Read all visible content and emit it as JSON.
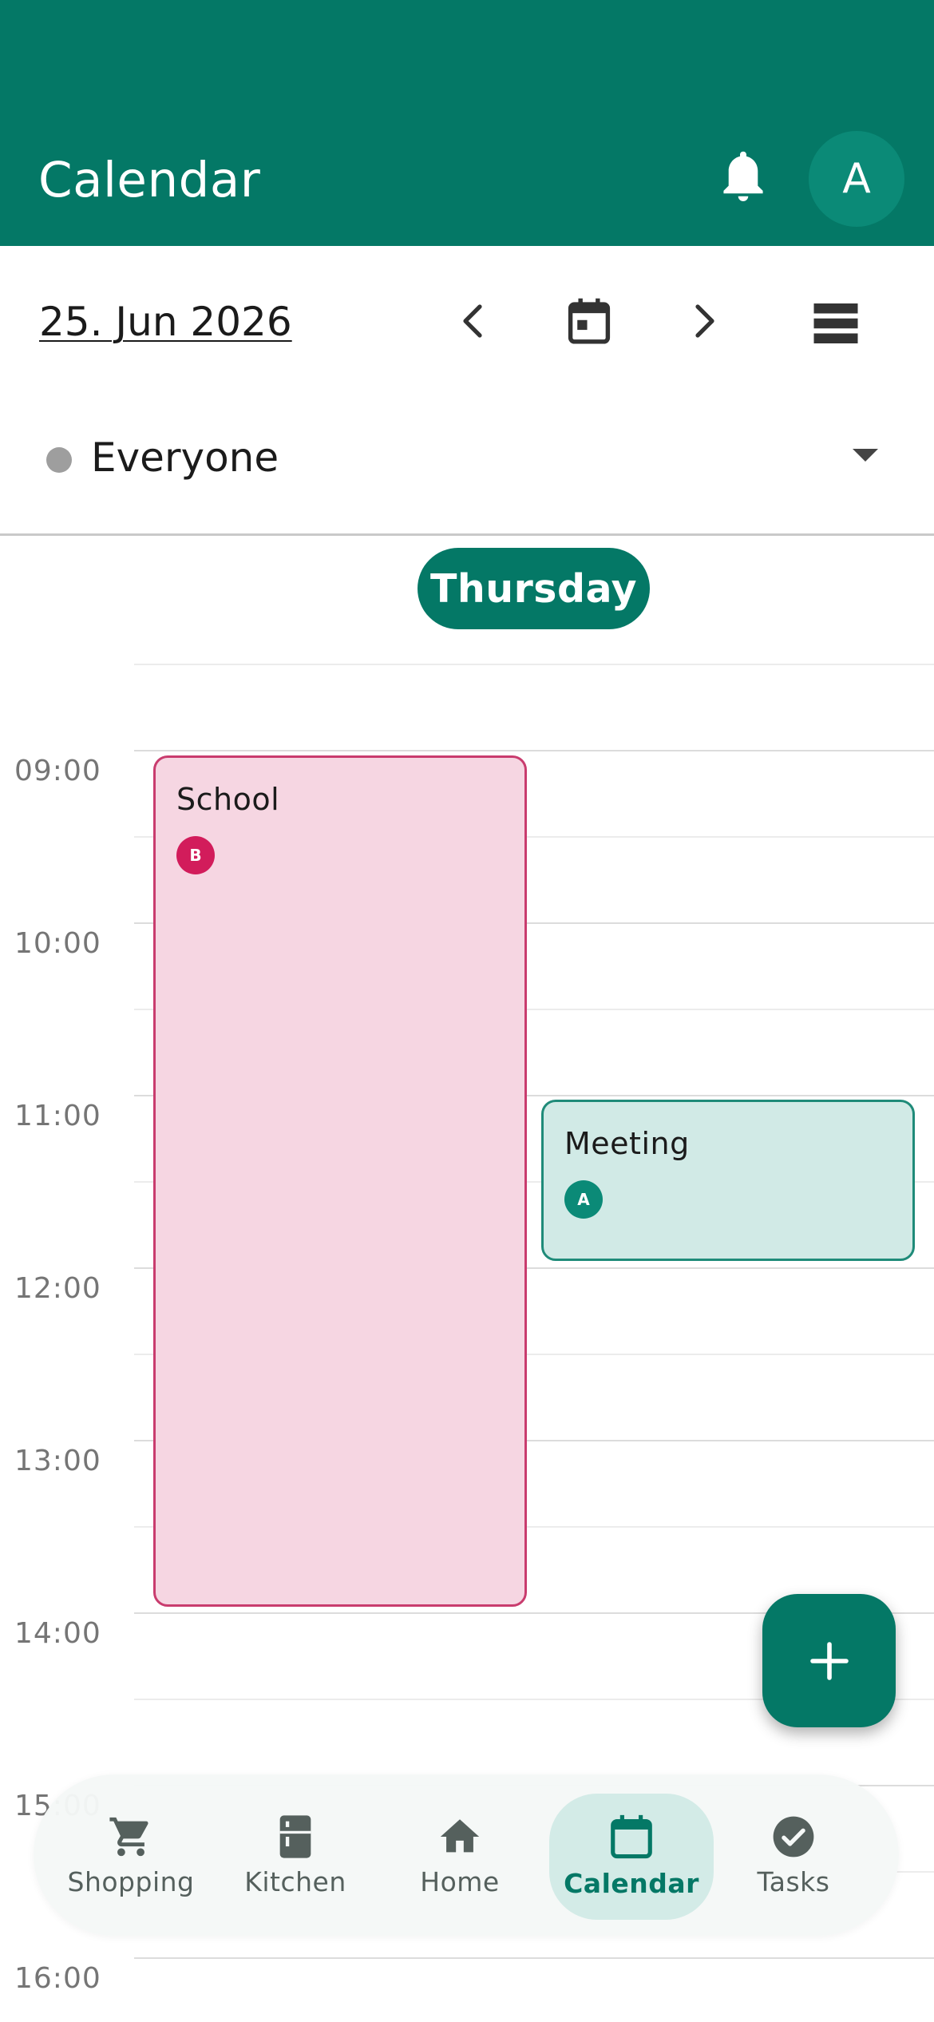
{
  "app_bar": {
    "title": "Calendar",
    "avatar_initial": "A"
  },
  "toolbar": {
    "date": "25. Jun 2026"
  },
  "filter": {
    "label": "Everyone"
  },
  "day": {
    "label": "Thursday"
  },
  "hours": [
    "09:00",
    "10:00",
    "11:00",
    "12:00",
    "13:00",
    "14:00",
    "15:00",
    "16:00"
  ],
  "events": [
    {
      "title": "School",
      "person_initial": "B",
      "color": "#d21c5b",
      "start": "09:00",
      "end": "14:00"
    },
    {
      "title": "Meeting",
      "person_initial": "A",
      "color": "#0b8a77",
      "start": "11:00",
      "end": "12:00"
    }
  ],
  "fab": {
    "label": "+"
  },
  "nav": {
    "items": [
      {
        "label": "Shopping",
        "icon": "cart-icon"
      },
      {
        "label": "Kitchen",
        "icon": "fridge-icon"
      },
      {
        "label": "Home",
        "icon": "home-icon"
      },
      {
        "label": "Calendar",
        "icon": "calendar-icon",
        "active": true
      },
      {
        "label": "Tasks",
        "icon": "check-circle-icon"
      }
    ]
  },
  "colors": {
    "primary": "#047866",
    "school": "#f6d6e2",
    "meeting": "#d1eae6"
  }
}
